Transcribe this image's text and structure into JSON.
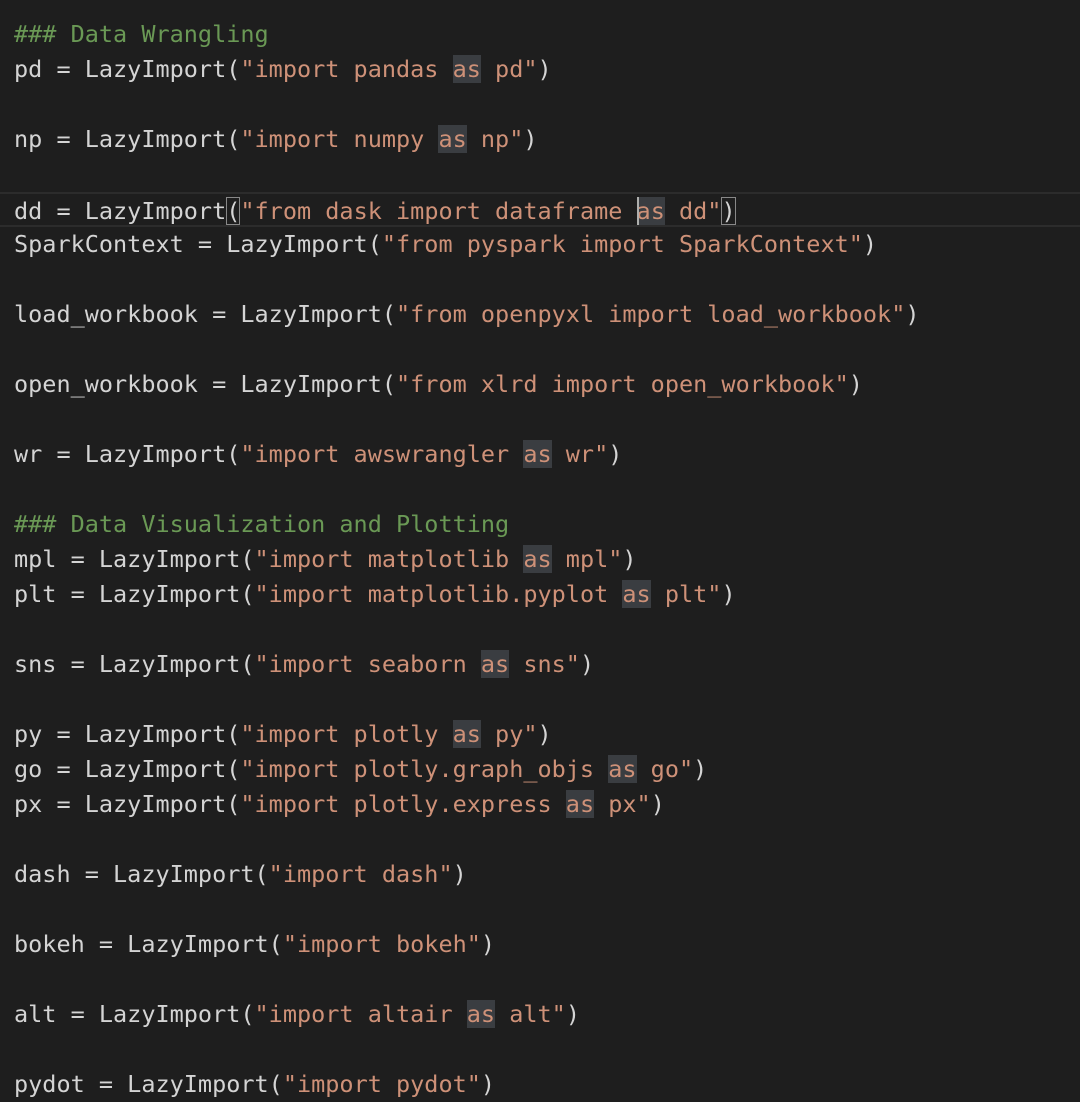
{
  "editor": {
    "lines": [
      {
        "segments": [
          {
            "text": "### Data Wrangling",
            "kind": "comment"
          }
        ]
      },
      {
        "segments": [
          {
            "text": "pd = LazyImport(",
            "kind": "plain"
          },
          {
            "text": "\"import pandas ",
            "kind": "str"
          },
          {
            "text": "as",
            "kind": "str-hl"
          },
          {
            "text": " pd\"",
            "kind": "str"
          },
          {
            "text": ")",
            "kind": "plain"
          }
        ]
      },
      {
        "segments": []
      },
      {
        "segments": [
          {
            "text": "np = LazyImport(",
            "kind": "plain"
          },
          {
            "text": "\"import numpy ",
            "kind": "str"
          },
          {
            "text": "as",
            "kind": "str-hl"
          },
          {
            "text": " np\"",
            "kind": "str"
          },
          {
            "text": ")",
            "kind": "plain"
          }
        ]
      },
      {
        "segments": []
      },
      {
        "current": true,
        "segments": [
          {
            "text": "dd = LazyImport",
            "kind": "plain"
          },
          {
            "text": "(",
            "kind": "bracket"
          },
          {
            "text": "\"from dask import dataframe ",
            "kind": "str"
          },
          {
            "text": "",
            "kind": "cursor"
          },
          {
            "text": "as",
            "kind": "str-hl"
          },
          {
            "text": " dd\"",
            "kind": "str"
          },
          {
            "text": ")",
            "kind": "bracket"
          }
        ]
      },
      {
        "segments": [
          {
            "text": "SparkContext = LazyImport(",
            "kind": "plain"
          },
          {
            "text": "\"from pyspark import SparkContext\"",
            "kind": "str"
          },
          {
            "text": ")",
            "kind": "plain"
          }
        ]
      },
      {
        "segments": []
      },
      {
        "segments": [
          {
            "text": "load_workbook = LazyImport(",
            "kind": "plain"
          },
          {
            "text": "\"from openpyxl import load_workbook\"",
            "kind": "str"
          },
          {
            "text": ")",
            "kind": "plain"
          }
        ]
      },
      {
        "segments": []
      },
      {
        "segments": [
          {
            "text": "open_workbook = LazyImport(",
            "kind": "plain"
          },
          {
            "text": "\"from xlrd import open_workbook\"",
            "kind": "str"
          },
          {
            "text": ")",
            "kind": "plain"
          }
        ]
      },
      {
        "segments": []
      },
      {
        "segments": [
          {
            "text": "wr = LazyImport(",
            "kind": "plain"
          },
          {
            "text": "\"import awswrangler ",
            "kind": "str"
          },
          {
            "text": "as",
            "kind": "str-hl"
          },
          {
            "text": " wr\"",
            "kind": "str"
          },
          {
            "text": ")",
            "kind": "plain"
          }
        ]
      },
      {
        "segments": []
      },
      {
        "segments": [
          {
            "text": "### Data Visualization and Plotting",
            "kind": "comment"
          }
        ]
      },
      {
        "segments": [
          {
            "text": "mpl = LazyImport(",
            "kind": "plain"
          },
          {
            "text": "\"import matplotlib ",
            "kind": "str"
          },
          {
            "text": "as",
            "kind": "str-hl"
          },
          {
            "text": " mpl\"",
            "kind": "str"
          },
          {
            "text": ")",
            "kind": "plain"
          }
        ]
      },
      {
        "segments": [
          {
            "text": "plt = LazyImport(",
            "kind": "plain"
          },
          {
            "text": "\"import matplotlib.pyplot ",
            "kind": "str"
          },
          {
            "text": "as",
            "kind": "str-hl"
          },
          {
            "text": " plt\"",
            "kind": "str"
          },
          {
            "text": ")",
            "kind": "plain"
          }
        ]
      },
      {
        "segments": []
      },
      {
        "segments": [
          {
            "text": "sns = LazyImport(",
            "kind": "plain"
          },
          {
            "text": "\"import seaborn ",
            "kind": "str"
          },
          {
            "text": "as",
            "kind": "str-hl"
          },
          {
            "text": " sns\"",
            "kind": "str"
          },
          {
            "text": ")",
            "kind": "plain"
          }
        ]
      },
      {
        "segments": []
      },
      {
        "segments": [
          {
            "text": "py = LazyImport(",
            "kind": "plain"
          },
          {
            "text": "\"import plotly ",
            "kind": "str"
          },
          {
            "text": "as",
            "kind": "str-hl"
          },
          {
            "text": " py\"",
            "kind": "str"
          },
          {
            "text": ")",
            "kind": "plain"
          }
        ]
      },
      {
        "segments": [
          {
            "text": "go = LazyImport(",
            "kind": "plain"
          },
          {
            "text": "\"import plotly.graph_objs ",
            "kind": "str"
          },
          {
            "text": "as",
            "kind": "str-hl"
          },
          {
            "text": " go\"",
            "kind": "str"
          },
          {
            "text": ")",
            "kind": "plain"
          }
        ]
      },
      {
        "segments": [
          {
            "text": "px = LazyImport(",
            "kind": "plain"
          },
          {
            "text": "\"import plotly.express ",
            "kind": "str"
          },
          {
            "text": "as",
            "kind": "str-hl"
          },
          {
            "text": " px\"",
            "kind": "str"
          },
          {
            "text": ")",
            "kind": "plain"
          }
        ]
      },
      {
        "segments": []
      },
      {
        "segments": [
          {
            "text": "dash = LazyImport(",
            "kind": "plain"
          },
          {
            "text": "\"import dash\"",
            "kind": "str"
          },
          {
            "text": ")",
            "kind": "plain"
          }
        ]
      },
      {
        "segments": []
      },
      {
        "segments": [
          {
            "text": "bokeh = LazyImport(",
            "kind": "plain"
          },
          {
            "text": "\"import bokeh\"",
            "kind": "str"
          },
          {
            "text": ")",
            "kind": "plain"
          }
        ]
      },
      {
        "segments": []
      },
      {
        "segments": [
          {
            "text": "alt = LazyImport(",
            "kind": "plain"
          },
          {
            "text": "\"import altair ",
            "kind": "str"
          },
          {
            "text": "as",
            "kind": "str-hl"
          },
          {
            "text": " alt\"",
            "kind": "str"
          },
          {
            "text": ")",
            "kind": "plain"
          }
        ]
      },
      {
        "segments": []
      },
      {
        "segments": [
          {
            "text": "pydot = LazyImport(",
            "kind": "plain"
          },
          {
            "text": "\"import pydot\"",
            "kind": "str"
          },
          {
            "text": ")",
            "kind": "plain"
          }
        ]
      }
    ]
  },
  "theme": {
    "background": "#1e1e1e",
    "plain": "#d4d4d4",
    "comment": "#6a9955",
    "string": "#ce9178",
    "selection_highlight": "#3a3d41"
  }
}
